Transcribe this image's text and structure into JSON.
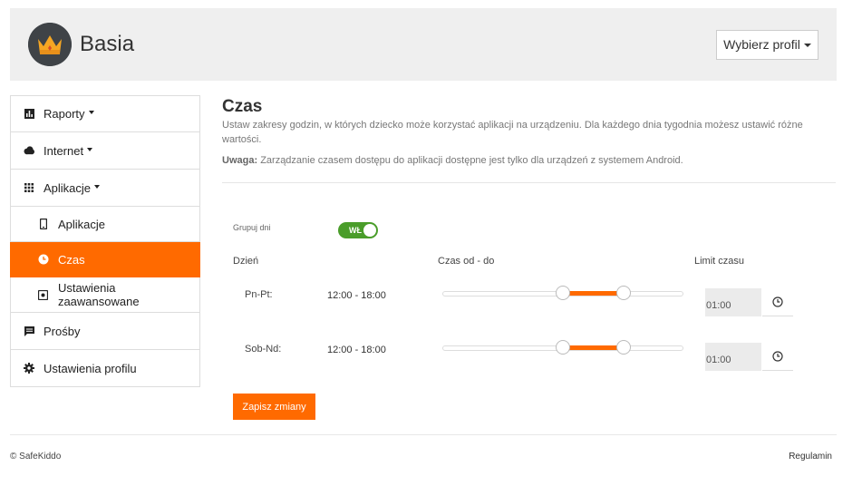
{
  "header": {
    "profile_name": "Basia",
    "profile_select_label": "Wybierz profil"
  },
  "sidebar": {
    "items": [
      {
        "label": "Raporty",
        "icon": "bar-chart-icon",
        "has_caret": true
      },
      {
        "label": "Internet",
        "icon": "cloud-icon",
        "has_caret": true
      },
      {
        "label": "Aplikacje",
        "icon": "grid-icon",
        "has_caret": true
      },
      {
        "label": "Aplikacje",
        "icon": "phone-icon",
        "sub": true
      },
      {
        "label": "Czas",
        "icon": "clock-icon",
        "sub": true,
        "active": true
      },
      {
        "label": "Ustawienia zaawansowane",
        "icon": "settings-box-icon",
        "sub": true
      },
      {
        "label": "Prośby",
        "icon": "message-icon"
      },
      {
        "label": "Ustawienia profilu",
        "icon": "gear-icon"
      }
    ]
  },
  "main": {
    "title": "Czas",
    "description": "Ustaw zakresy godzin, w których dziecko może korzystać aplikacji na urządzeniu. Dla każdego dnia tygodnia możesz ustawić różne wartości.",
    "note_label": "Uwaga:",
    "note_text": "Zarządzanie czasem dostępu do aplikacji dostępne jest tylko dla urządzeń z systemem Android.",
    "group_days_label": "Grupuj dni",
    "group_days_toggle": "WŁ",
    "columns": {
      "day": "Dzień",
      "time_range": "Czas od - do",
      "limit": "Limit czasu"
    },
    "rows": [
      {
        "day": "Pn-Pt:",
        "time": "12:00 - 18:00",
        "range_start_h": 12,
        "range_end_h": 18,
        "limit": "01:00"
      },
      {
        "day": "Sob-Nd:",
        "time": "12:00 - 18:00",
        "range_start_h": 12,
        "range_end_h": 18,
        "limit": "01:00"
      }
    ],
    "save_label": "Zapisz zmiany"
  },
  "footer": {
    "copyright": "© SafeKiddo",
    "regulamin": "Regulamin"
  },
  "colors": {
    "accent": "#ff6a00",
    "toggle_on": "#4a9d2a"
  }
}
